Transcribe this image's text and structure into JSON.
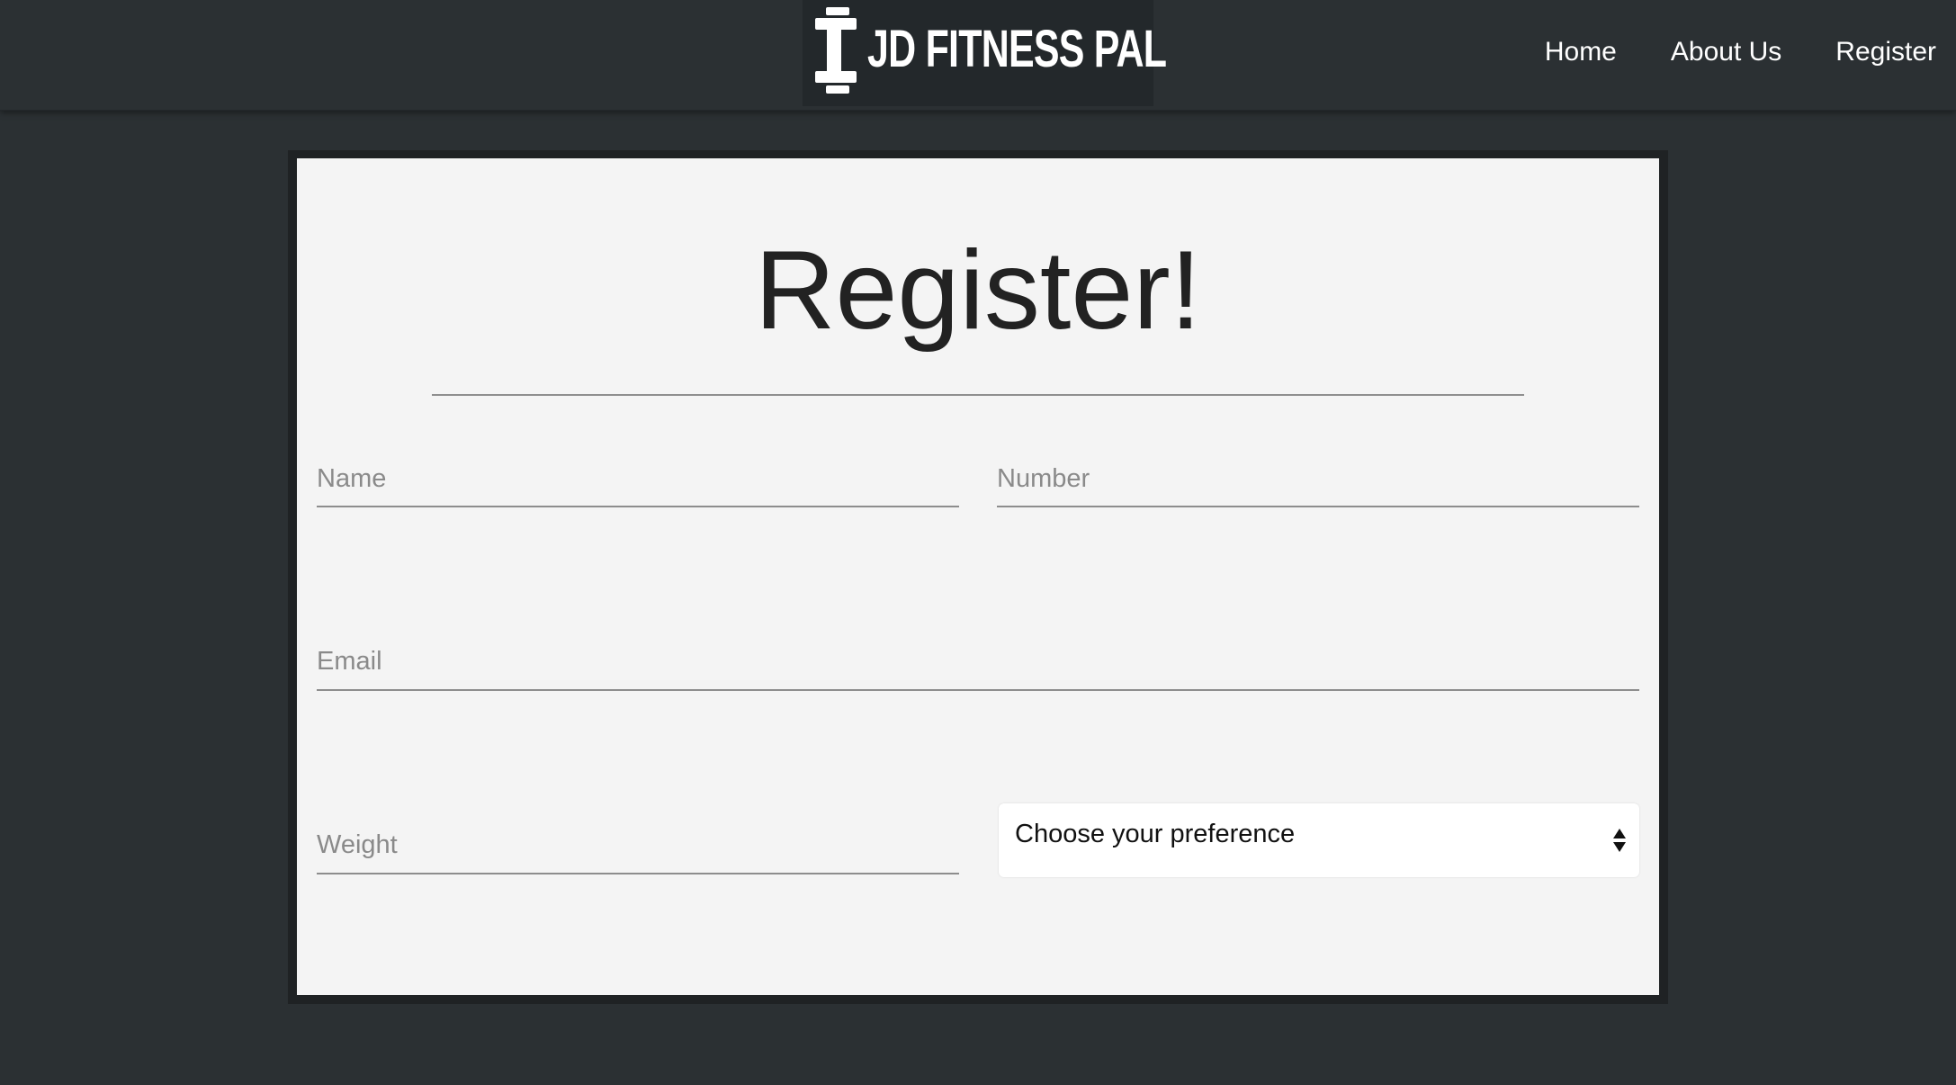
{
  "header": {
    "logo_text": "JD FITNESS PAL",
    "logo_icon": "dumbbell-icon",
    "nav": [
      {
        "label": "Home"
      },
      {
        "label": "About Us"
      },
      {
        "label": "Register"
      }
    ]
  },
  "form": {
    "title": "Register!",
    "fields": {
      "name": {
        "placeholder": "Name",
        "value": ""
      },
      "number": {
        "placeholder": "Number",
        "value": ""
      },
      "email": {
        "placeholder": "Email",
        "value": ""
      },
      "weight": {
        "placeholder": "Weight",
        "value": ""
      }
    },
    "preference": {
      "selected": "Choose your preference",
      "icon": "sort-arrows-icon"
    }
  },
  "colors": {
    "background": "#2b3033",
    "card": "#f4f4f4",
    "card_border": "#1f2224",
    "text_dark": "#222222",
    "placeholder": "#8a8a8a"
  }
}
